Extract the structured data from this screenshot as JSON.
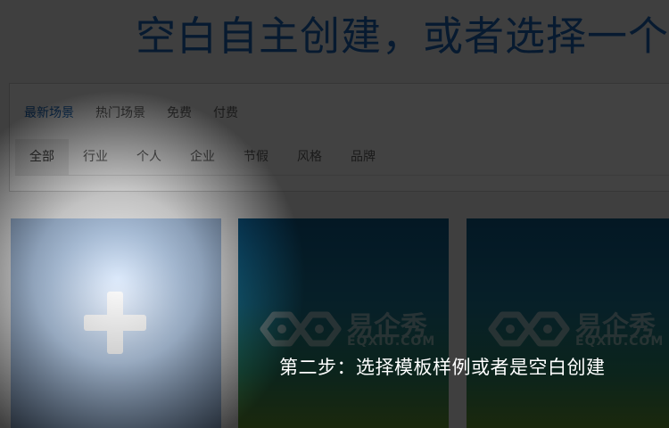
{
  "header": {
    "title": "空白自主创建，或者选择一个"
  },
  "scene_tabs": [
    {
      "label": "最新场景",
      "active": true
    },
    {
      "label": "热门场景",
      "active": false
    },
    {
      "label": "免费",
      "active": false
    },
    {
      "label": "付费",
      "active": false
    }
  ],
  "categories": [
    {
      "label": "全部",
      "active": true
    },
    {
      "label": "行业",
      "active": false
    },
    {
      "label": "个人",
      "active": false
    },
    {
      "label": "企业",
      "active": false
    },
    {
      "label": "节假",
      "active": false
    },
    {
      "label": "风格",
      "active": false
    },
    {
      "label": "品牌",
      "active": false
    }
  ],
  "cards": {
    "blank": {
      "icon": "plus-icon"
    },
    "templates": [
      {
        "brand_cn": "易企秀",
        "brand_en": "EQXIU.COM"
      },
      {
        "brand_cn": "易企秀",
        "brand_en": "EQXIU.COM"
      }
    ]
  },
  "caption": "第二步：选择模板样例或者是空白创建",
  "colors": {
    "accent": "#1a66b8",
    "overlay": "#000000"
  }
}
